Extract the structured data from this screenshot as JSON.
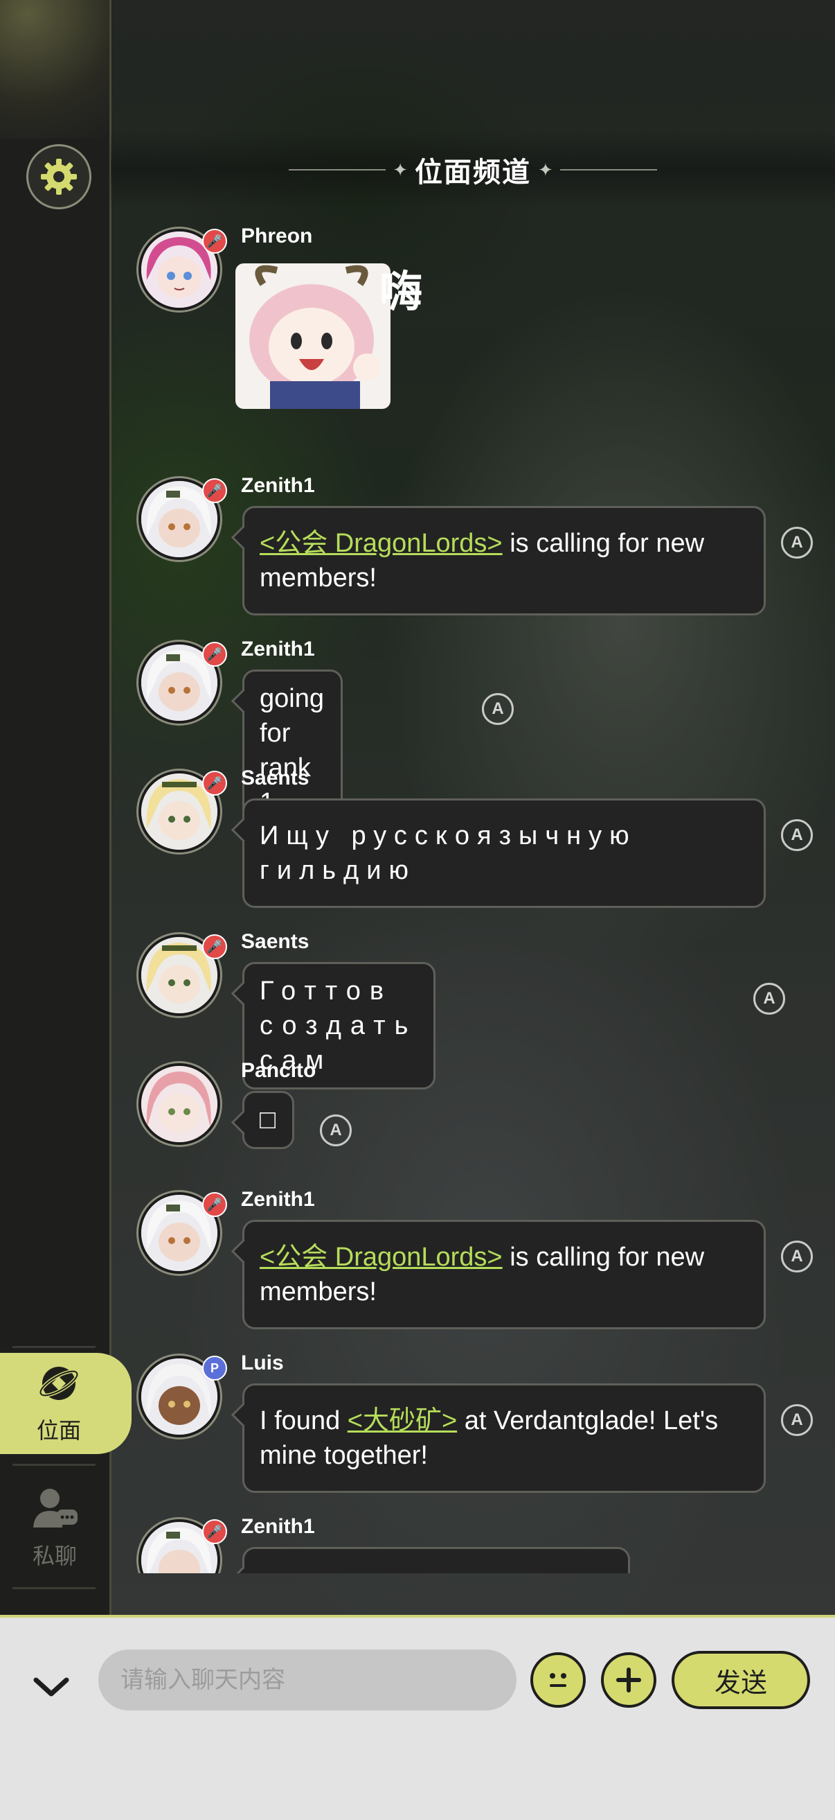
{
  "channel": {
    "title": "位面频道"
  },
  "sidebar": {
    "tabs": [
      {
        "label": "位面",
        "active": true
      },
      {
        "label": "私聊",
        "active": false
      }
    ]
  },
  "messages": [
    {
      "user": "Phreon",
      "badge": "red",
      "type": "sticker",
      "text": "嗨"
    },
    {
      "user": "Zenith1",
      "badge": "red",
      "link": "<公会 DragonLords>",
      "text": " is calling for new members!"
    },
    {
      "user": "Zenith1",
      "badge": "red",
      "text": "going for rank 1"
    },
    {
      "user": "Saents",
      "badge": "red",
      "text": "Ищу русскоязычную гильдию"
    },
    {
      "user": "Saents",
      "badge": "red",
      "text": "Готтов создать сам"
    },
    {
      "user": "Pancito",
      "badge": "none",
      "text": "□"
    },
    {
      "user": "Zenith1",
      "badge": "red",
      "link": "<公会 DragonLords>",
      "text": " is calling for new members!"
    },
    {
      "user": "Luis",
      "badge": "blue",
      "prefix": "I found ",
      "link": "<大砂矿>",
      "text": " at Verdantglade! Let's mine together!"
    },
    {
      "user": "Zenith1",
      "badge": "red",
      "text": ""
    }
  ],
  "input": {
    "placeholder": "请输入聊天内容",
    "value": "",
    "send_label": "发送"
  },
  "colors": {
    "accent": "#d4da6e",
    "link": "#b6dd5a",
    "bubble": "#232323",
    "badge_red": "#e24949",
    "badge_blue": "#5a6fd8"
  },
  "icons": [
    "settings-icon",
    "world-icon",
    "private-chat-icon",
    "translate-icon",
    "chevron-down-icon",
    "emoji-icon",
    "plus-icon"
  ]
}
